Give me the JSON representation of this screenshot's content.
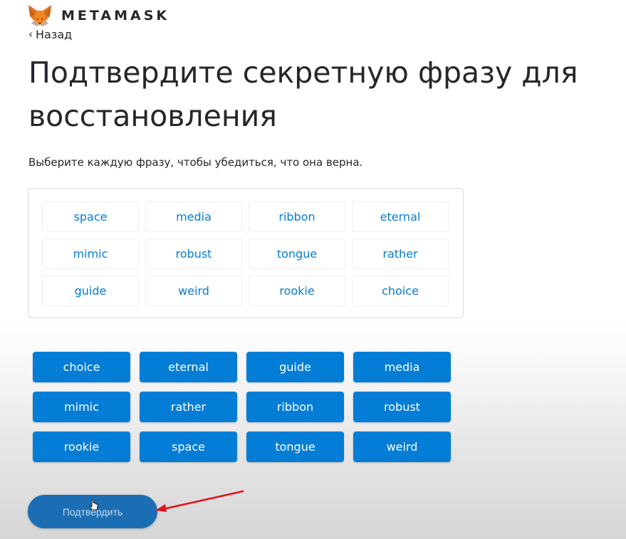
{
  "header": {
    "brand": "METAMASK",
    "logo_icon": "metamask-fox-icon"
  },
  "nav": {
    "back_label": "Назад",
    "back_icon": "chevron-left-icon"
  },
  "page": {
    "title": "Подтвердите секретную фразу для восстановления",
    "subtitle": "Выберите каждую фразу, чтобы убедиться, что она верна."
  },
  "drop_area": {
    "words": [
      "space",
      "media",
      "ribbon",
      "eternal",
      "mimic",
      "robust",
      "tongue",
      "rather",
      "guide",
      "weird",
      "rookie",
      "choice"
    ]
  },
  "word_pool": {
    "words": [
      "choice",
      "eternal",
      "guide",
      "media",
      "mimic",
      "rather",
      "ribbon",
      "robust",
      "rookie",
      "space",
      "tongue",
      "weird"
    ]
  },
  "actions": {
    "confirm_label": "Подтвердить"
  },
  "colors": {
    "accent": "#037dd6",
    "confirm_bg": "#1b6eb3",
    "annotation": "#e0121b"
  }
}
